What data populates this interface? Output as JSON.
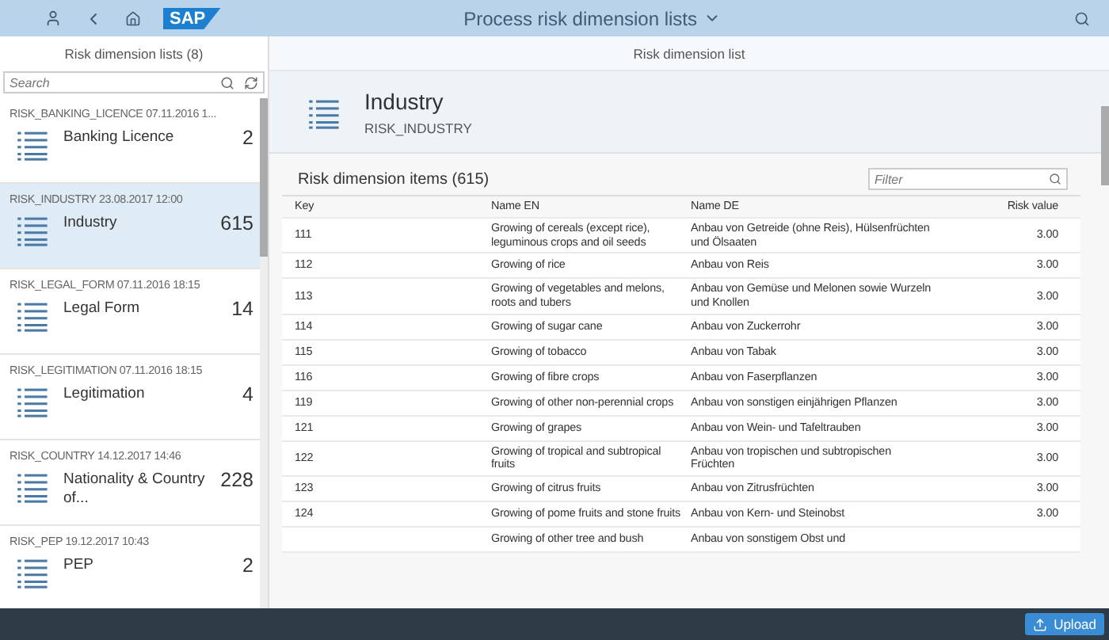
{
  "shell": {
    "logo": "SAP",
    "title": "Process risk dimension lists"
  },
  "master": {
    "title": "Risk dimension lists (8)",
    "search": {
      "placeholder": "Search"
    },
    "items": [
      {
        "meta": "RISK_BANKING_LICENCE 07.11.2016 1...",
        "name": "Banking Licence",
        "count": "2",
        "selected": false
      },
      {
        "meta": "RISK_INDUSTRY 23.08.2017 12:00",
        "name": "Industry",
        "count": "615",
        "selected": true
      },
      {
        "meta": "RISK_LEGAL_FORM 07.11.2016 18:15",
        "name": "Legal Form",
        "count": "14",
        "selected": false
      },
      {
        "meta": "RISK_LEGITIMATION 07.11.2016 18:15",
        "name": "Legitimation",
        "count": "4",
        "selected": false
      },
      {
        "meta": "RISK_COUNTRY 14.12.2017 14:46",
        "name": "Nationality & Country of...",
        "count": "228",
        "selected": false
      },
      {
        "meta": "RISK_PEP 19.12.2017 10:43",
        "name": "PEP",
        "count": "2",
        "selected": false
      }
    ]
  },
  "detail": {
    "title": "Risk dimension list",
    "object": {
      "name": "Industry",
      "id": "RISK_INDUSTRY"
    },
    "table": {
      "title": "Risk dimension items (615)",
      "filter": {
        "placeholder": "Filter"
      },
      "columns": [
        "Key",
        "Name EN",
        "Name DE",
        "Risk value"
      ],
      "rows": [
        [
          "111",
          "Growing of cereals (except rice), leguminous crops and oil seeds",
          "Anbau von Getreide (ohne Reis), Hülsenfrüchten und Ölsaaten",
          "3.00"
        ],
        [
          "112",
          "Growing of rice",
          "Anbau von Reis",
          "3.00"
        ],
        [
          "113",
          "Growing of vegetables and melons, roots and tubers",
          "Anbau von Gemüse und Melonen sowie Wurzeln und Knollen",
          "3.00"
        ],
        [
          "114",
          "Growing of sugar cane",
          "Anbau von Zuckerrohr",
          "3.00"
        ],
        [
          "115",
          "Growing of tobacco",
          "Anbau von Tabak",
          "3.00"
        ],
        [
          "116",
          "Growing of fibre crops",
          "Anbau von Faserpflanzen",
          "3.00"
        ],
        [
          "119",
          "Growing of other non-perennial crops",
          "Anbau von sonstigen einjährigen Pflanzen",
          "3.00"
        ],
        [
          "121",
          "Growing of grapes",
          "Anbau von Wein- und Tafeltrauben",
          "3.00"
        ],
        [
          "122",
          "Growing of tropical and subtropical fruits",
          "Anbau von tropischen und subtropischen Früchten",
          "3.00"
        ],
        [
          "123",
          "Growing of citrus fruits",
          "Anbau von Zitrusfrüchten",
          "3.00"
        ],
        [
          "124",
          "Growing of pome fruits and stone fruits",
          "Anbau von Kern- und Steinobst",
          "3.00"
        ],
        [
          "",
          "Growing of other tree and bush",
          "Anbau von sonstigem Obst und",
          ""
        ]
      ]
    }
  },
  "footer": {
    "upload": "Upload"
  }
}
